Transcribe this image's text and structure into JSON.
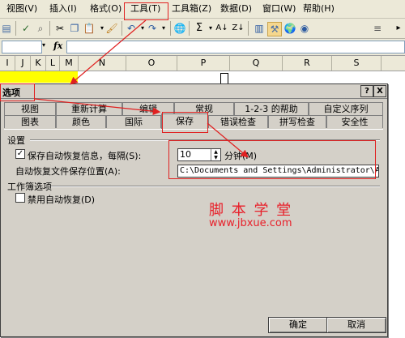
{
  "menubar": {
    "items": [
      "视图(V)",
      "插入(I)",
      "格式(O)",
      "工具(T)",
      "工具箱(Z)",
      "数据(D)",
      "窗口(W)",
      "帮助(H)"
    ]
  },
  "toolbar": {
    "sigma": "Σ",
    "more": "▸"
  },
  "formula_bar": {
    "fx_label": "fx"
  },
  "columns": [
    "I",
    "J",
    "K",
    "L",
    "M",
    "N",
    "O",
    "P",
    "Q",
    "R",
    "S"
  ],
  "dialog": {
    "title": "选项",
    "help_button": "?",
    "close_button": "X",
    "tabs_row1": [
      "视图",
      "重新计算",
      "编辑",
      "常规",
      "1-2-3 的帮助",
      "自定义序列"
    ],
    "tabs_row2": [
      "图表",
      "颜色",
      "国际",
      "保存",
      "错误检查",
      "拼写检查",
      "安全性"
    ],
    "settings": {
      "group_label": "设置",
      "autosave_label": "保存自动恢复信息，每隔(S):",
      "autosave_checked": "✓",
      "autosave_value": "10",
      "autosave_unit": "分钟(M)",
      "location_label": "自动恢复文件保存位置(A):",
      "location_value": "C:\\Documents and Settings\\Administrator\\Applic"
    },
    "workbook": {
      "group_label": "工作簿选项",
      "disable_label": "禁用自动恢复(D)"
    },
    "ok_button": "确定",
    "cancel_button": "取消"
  },
  "watermark": {
    "name": "脚 本 学 堂",
    "url": "www.jbxue.com"
  },
  "colors": {
    "annotation_red": "#e02020",
    "watermark_red": "#e8202a",
    "highlight_yellow": "#ffff00"
  }
}
